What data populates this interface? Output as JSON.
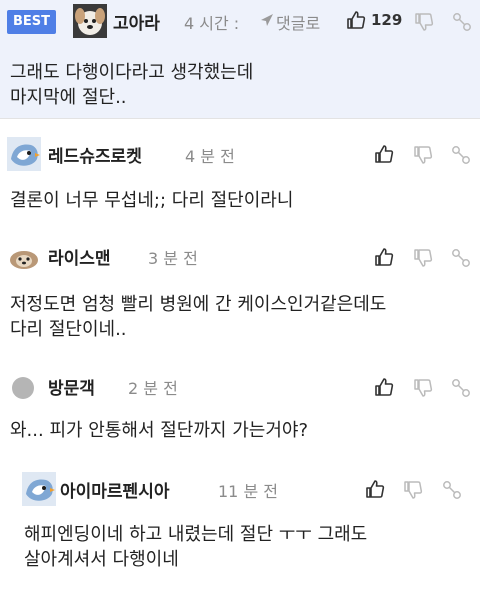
{
  "comments": [
    {
      "badge": "BEST",
      "nickname": "고아라",
      "time": "4 시간 :",
      "reply_label": "댓글로",
      "like_count": "129",
      "lines": [
        "그래도 다행이다라고 생각했는데",
        "마지막에 절단.."
      ],
      "avatar": "avatar-dog-icon"
    },
    {
      "nickname": "레드슈즈로켓",
      "time": "4 분 전",
      "lines": [
        "결론이 너무 무섭네;; 다리 절단이라니"
      ],
      "avatar": "avatar-bird-icon"
    },
    {
      "nickname": "라이스맨",
      "time": "3 분 전",
      "lines": [
        "저정도면 엄청 빨리 병원에 간 케이스인거같은데도",
        "다리 절단이네.."
      ],
      "avatar": "avatar-puppy-icon"
    },
    {
      "nickname": "방문객",
      "time": "2 분 전",
      "lines": [
        "와... 피가 안통해서 절단까지 가는거야?"
      ],
      "avatar": "avatar-default-icon"
    },
    {
      "nickname": "아이마르펜시아",
      "time": "11 분 전",
      "lines": [
        "해피엔딩이네 하고 내렸는데 절단 ㅜㅜ 그래도",
        "살아계셔서 다행이네"
      ],
      "avatar": "avatar-bird-icon"
    }
  ],
  "colors": {
    "badge": "#4f7fe6",
    "best_bg": "#eef2fb",
    "muted": "#8b8b8b"
  }
}
